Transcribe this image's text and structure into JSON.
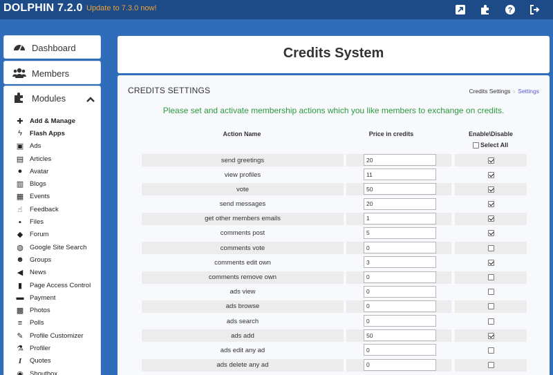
{
  "app": {
    "brand": "DOLPHIN 7.2.0",
    "update_text": "Update to 7.3.0 now!",
    "top_icons": [
      "external-link-icon",
      "puzzle-icon",
      "help-icon",
      "logout-icon"
    ]
  },
  "sidebar": {
    "dashboard": "Dashboard",
    "members": "Members",
    "modules": "Modules",
    "items": [
      {
        "label": "Add & Manage",
        "icon": "plus-icon",
        "bold": true
      },
      {
        "label": "Flash Apps",
        "icon": "bolt-icon",
        "bold": true
      },
      {
        "label": "Ads",
        "icon": "money-icon"
      },
      {
        "label": "Articles",
        "icon": "file-icon"
      },
      {
        "label": "Avatar",
        "icon": "user-icon"
      },
      {
        "label": "Blogs",
        "icon": "book-icon"
      },
      {
        "label": "Events",
        "icon": "calendar-icon"
      },
      {
        "label": "Feedback",
        "icon": "thumbs-up-icon"
      },
      {
        "label": "Files",
        "icon": "floppy-icon"
      },
      {
        "label": "Forum",
        "icon": "comments-icon"
      },
      {
        "label": "Google Site Search",
        "icon": "globe-icon"
      },
      {
        "label": "Groups",
        "icon": "users-icon"
      },
      {
        "label": "News",
        "icon": "bullhorn-icon"
      },
      {
        "label": "Page Access Control",
        "icon": "unlock-icon"
      },
      {
        "label": "Payment",
        "icon": "credit-card-icon"
      },
      {
        "label": "Photos",
        "icon": "picture-icon"
      },
      {
        "label": "Polls",
        "icon": "list-icon"
      },
      {
        "label": "Profile Customizer",
        "icon": "magic-icon"
      },
      {
        "label": "Profiler",
        "icon": "flask-icon"
      },
      {
        "label": "Quotes",
        "icon": "italic-icon"
      },
      {
        "label": "Shoutbox",
        "icon": "chat-icon"
      }
    ]
  },
  "main": {
    "page_title": "Credits System",
    "section_title": "CREDITS SETTINGS",
    "breadcrumb": [
      "Credits Settings",
      "Settings"
    ],
    "notice": "Please set and activate membership actions which you like members to exchange on credits.",
    "columns": [
      "Action Name",
      "Price in credits",
      "Enable\\Disable"
    ],
    "select_all": "Select All",
    "rows": [
      {
        "name": "send greetings",
        "price": "20",
        "enabled": true
      },
      {
        "name": "view profiles",
        "price": "11",
        "enabled": true
      },
      {
        "name": "vote",
        "price": "50",
        "enabled": true
      },
      {
        "name": "send messages",
        "price": "20",
        "enabled": true
      },
      {
        "name": "get other members emails",
        "price": "1",
        "enabled": true
      },
      {
        "name": "comments post",
        "price": "5",
        "enabled": true
      },
      {
        "name": "comments vote",
        "price": "0",
        "enabled": false
      },
      {
        "name": "comments edit own",
        "price": "3",
        "enabled": true
      },
      {
        "name": "comments remove own",
        "price": "0",
        "enabled": false
      },
      {
        "name": "ads view",
        "price": "0",
        "enabled": false
      },
      {
        "name": "ads browse",
        "price": "0",
        "enabled": false
      },
      {
        "name": "ads search",
        "price": "0",
        "enabled": false
      },
      {
        "name": "ads add",
        "price": "50",
        "enabled": true
      },
      {
        "name": "ads edit any ad",
        "price": "0",
        "enabled": false
      },
      {
        "name": "ads delete any ad",
        "price": "0",
        "enabled": false
      }
    ]
  },
  "colors": {
    "background": "#2f6cb9",
    "topbar": "#1d4b87",
    "update_link": "#f0a23a",
    "notice": "#2c9a3e",
    "breadcrumb_current": "#5a5bd0",
    "row_shade": "#ececec"
  }
}
